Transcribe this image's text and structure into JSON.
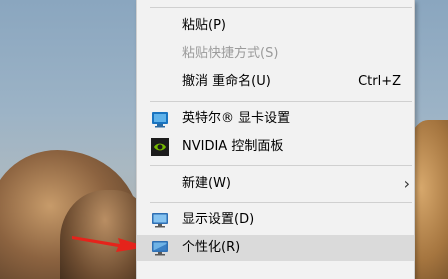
{
  "menu": {
    "items": [
      {
        "label": "粘贴(P)"
      },
      {
        "label": "粘贴快捷方式(S)"
      },
      {
        "label": "撤消 重命名(U)",
        "shortcut": "Ctrl+Z"
      },
      {
        "label": "英特尔® 显卡设置",
        "icon": "intel-graphics-icon"
      },
      {
        "label": "NVIDIA 控制面板",
        "icon": "nvidia-icon"
      },
      {
        "label": "新建(W)",
        "submenu_glyph": "›"
      },
      {
        "label": "显示设置(D)",
        "icon": "display-settings-icon"
      },
      {
        "label": "个性化(R)",
        "icon": "personalize-icon"
      }
    ]
  },
  "colors": {
    "menu_bg": "#f2f2f2",
    "hover_bg": "#dadada",
    "disabled_text": "#9b9b9b",
    "arrow": "#e5231b"
  }
}
